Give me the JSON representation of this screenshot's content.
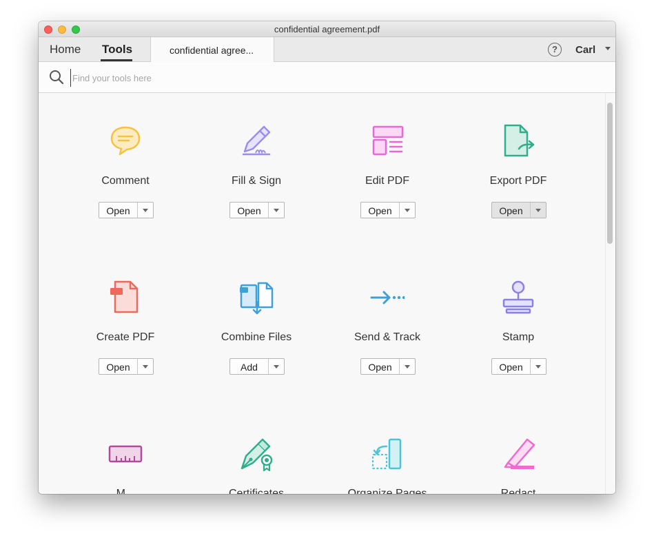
{
  "window": {
    "title": "confidential agreement.pdf"
  },
  "nav": {
    "home_label": "Home",
    "tools_label": "Tools",
    "doc_tab_label": "confidential agree...",
    "help_symbol": "?",
    "user_label": "Carl"
  },
  "search": {
    "placeholder": "Find your tools here",
    "value": ""
  },
  "tools": [
    {
      "name": "Comment",
      "button": "Open",
      "icon": "comment-icon",
      "color": "#f5c242"
    },
    {
      "name": "Fill & Sign",
      "button": "Open",
      "icon": "fill-sign-icon",
      "color": "#9d8cf0"
    },
    {
      "name": "Edit PDF",
      "button": "Open",
      "icon": "edit-pdf-icon",
      "color": "#e868d8"
    },
    {
      "name": "Export PDF",
      "button": "Open",
      "icon": "export-pdf-icon",
      "color": "#2fae8c"
    },
    {
      "name": "Create PDF",
      "button": "Open",
      "icon": "create-pdf-icon",
      "color": "#ec6a5c"
    },
    {
      "name": "Combine Files",
      "button": "Add",
      "icon": "combine-files-icon",
      "color": "#3fa0d8"
    },
    {
      "name": "Send & Track",
      "button": "Open",
      "icon": "send-track-icon",
      "color": "#3fa0d8"
    },
    {
      "name": "Stamp",
      "button": "Open",
      "icon": "stamp-icon",
      "color": "#8a80e8"
    },
    {
      "name": "M...",
      "button": "",
      "icon": "measure-icon",
      "color": "#b04a9a"
    },
    {
      "name": "Certificates",
      "button": "",
      "icon": "certificates-icon",
      "color": "#2fae8c"
    },
    {
      "name": "Organize Pages",
      "button": "",
      "icon": "organize-pages-icon",
      "color": "#4cc4d8"
    },
    {
      "name": "Redact",
      "button": "",
      "icon": "redact-icon",
      "color": "#f06ad0"
    }
  ]
}
